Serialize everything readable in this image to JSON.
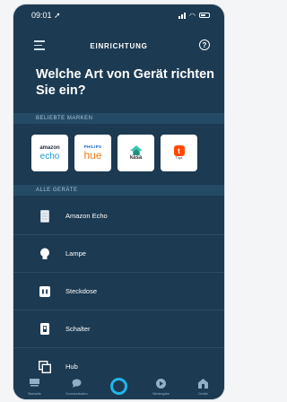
{
  "status": {
    "time": "09:01"
  },
  "topbar": {
    "title": "EINRICHTUNG"
  },
  "headline": "Welche Art von Gerät richten Sie ein?",
  "sections": {
    "popular_brands": "BELIEBTE MARKEN",
    "all_devices": "ALLE GERÄTE"
  },
  "brands": [
    {
      "name": "amazon echo",
      "line1": "amazon",
      "line2": "echo"
    },
    {
      "name": "philips hue",
      "line1": "PHILIPS",
      "line2": "hue"
    },
    {
      "name": "kasa",
      "line1": "kasa"
    },
    {
      "name": "tuya",
      "line1": "Tuya"
    }
  ],
  "devices": [
    {
      "label": "Amazon Echo",
      "icon": "echo-speaker-icon"
    },
    {
      "label": "Lampe",
      "icon": "bulb-icon"
    },
    {
      "label": "Steckdose",
      "icon": "plug-icon"
    },
    {
      "label": "Schalter",
      "icon": "switch-icon"
    },
    {
      "label": "Hub",
      "icon": "hub-icon"
    }
  ],
  "bottom_nav": [
    {
      "label": "Startseite",
      "icon": "home-icon"
    },
    {
      "label": "Kommunikation",
      "icon": "chat-icon"
    },
    {
      "label": "",
      "icon": "alexa-icon"
    },
    {
      "label": "Wiedergabe",
      "icon": "play-icon"
    },
    {
      "label": "Geräte",
      "icon": "devices-icon"
    }
  ],
  "colors": {
    "background": "#1c3a52",
    "section_bar": "#254a66",
    "accent": "#1fb6e8",
    "hue_orange": "#ef7d22",
    "tuya_red": "#ff4800"
  }
}
